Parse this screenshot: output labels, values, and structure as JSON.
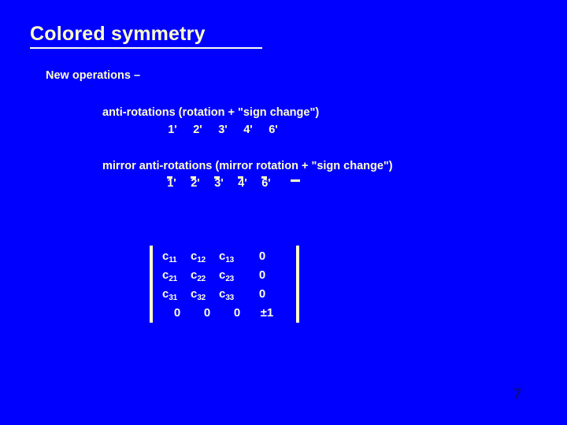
{
  "slide": {
    "background_color": "#0000ff",
    "text_color": "#ffffcc",
    "title": "Colored symmetry",
    "page_number": "7",
    "page_number_color": "#0a0a8c"
  },
  "body": {
    "new_operations_label": "New operations –",
    "anti_rotations_heading": "anti-rotations (rotation + \"sign change\")",
    "anti_rotation_symbols": [
      "1'",
      "2'",
      "3'",
      "4'",
      "6'"
    ],
    "mirror_anti_rotations_heading": "mirror anti-rotations (mirror rotation + \"sign change\")",
    "mirror_anti_rotation_symbols": [
      "1'",
      "2'",
      "3'",
      "4'",
      "6'"
    ]
  },
  "matrix": {
    "rows": [
      [
        "c11",
        "c12",
        "c13",
        "0"
      ],
      [
        "c21",
        "c22",
        "c23",
        "0"
      ],
      [
        "c31",
        "c32",
        "c33",
        "0"
      ],
      [
        "0",
        "0",
        "0",
        "±1"
      ]
    ],
    "cells": {
      "r1c1_base": "c",
      "r1c1_sub": "11",
      "r1c2_base": "c",
      "r1c2_sub": "12",
      "r1c3_base": "c",
      "r1c3_sub": "13",
      "r1c4": "0",
      "r2c1_base": "c",
      "r2c1_sub": "21",
      "r2c2_base": "c",
      "r2c2_sub": "22",
      "r2c3_base": "c",
      "r2c3_sub": "23",
      "r2c4": "0",
      "r3c1_base": "c",
      "r3c1_sub": "31",
      "r3c2_base": "c",
      "r3c2_sub": "32",
      "r3c3_base": "c",
      "r3c3_sub": "33",
      "r3c4": "0",
      "r4c1": "0",
      "r4c2": "0",
      "r4c3": "0",
      "r4c4": "±1"
    }
  }
}
